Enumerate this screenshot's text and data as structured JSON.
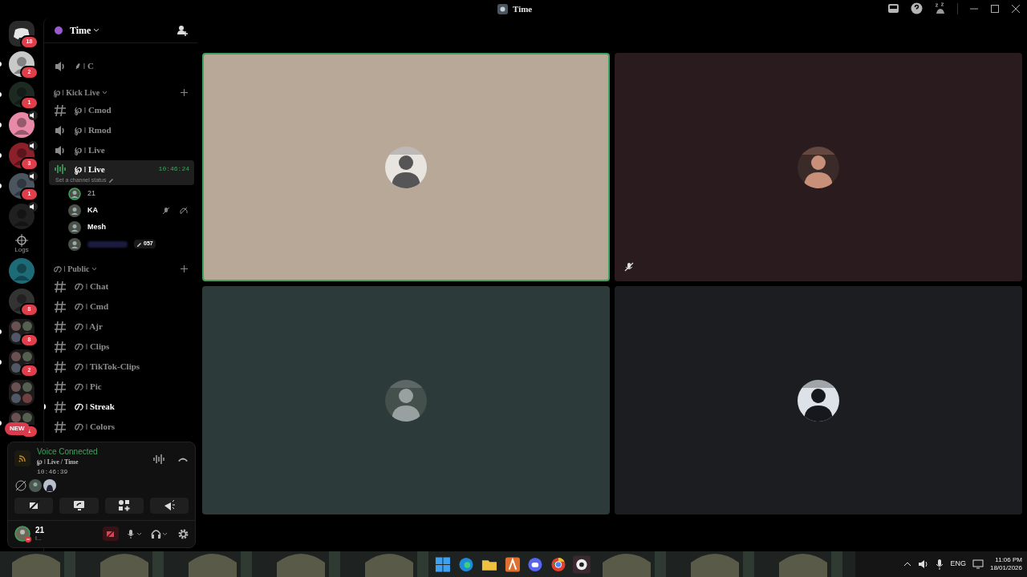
{
  "titlebar": {
    "title": "Time"
  },
  "servers": [
    {
      "kind": "home",
      "badge": "18",
      "speaker": false,
      "unread": false
    },
    {
      "kind": "avatar",
      "badge": "2",
      "speaker": false,
      "unread": true
    },
    {
      "kind": "avatar",
      "badge": "1",
      "speaker": false,
      "unread": true
    },
    {
      "kind": "avatar",
      "speaker": true,
      "unread": true
    },
    {
      "kind": "avatar",
      "badge": "3",
      "speaker": true,
      "unread": true
    },
    {
      "kind": "avatar",
      "badge": "1",
      "speaker": true,
      "unread": true
    },
    {
      "kind": "avatar",
      "speaker": true,
      "unread": false
    },
    {
      "kind": "logs",
      "label": "Logs",
      "speaker": false,
      "unread": false
    },
    {
      "kind": "avatar",
      "speaker": false,
      "unread": false
    },
    {
      "kind": "avatar",
      "badge": "8",
      "speaker": false,
      "unread": false
    },
    {
      "kind": "folder",
      "badge": "8",
      "speaker": false,
      "unread": true
    },
    {
      "kind": "folder",
      "badge": "2",
      "speaker": false,
      "unread": true
    },
    {
      "kind": "folder",
      "speaker": false,
      "unread": false
    },
    {
      "kind": "folder",
      "badge": "1",
      "speaker": false,
      "unread": true
    }
  ],
  "new_badge": "NEW",
  "guild": {
    "name": "Time"
  },
  "channels": [
    {
      "kind": "voice",
      "name": "⸙ ǀ C",
      "selected": false,
      "unread": false
    },
    {
      "kind": "category",
      "name": "℘ ǀ Kick Live"
    },
    {
      "kind": "text",
      "name": "℘ ǀ Cmod",
      "selected": false,
      "unread": false
    },
    {
      "kind": "voice",
      "name": "℘ ǀ Rmod",
      "selected": false,
      "unread": false
    },
    {
      "kind": "voice",
      "name": "℘ ǀ Live",
      "selected": false,
      "unread": false
    },
    {
      "kind": "voice",
      "name": "℘ ǀ Live",
      "selected": true,
      "unread": false,
      "timer": "10:46:24",
      "status": "Set a channel status",
      "children": [
        {
          "name": "21",
          "speaking": true,
          "muted": false
        },
        {
          "name": "KA",
          "speaking": false,
          "muted": true
        },
        {
          "name": "Mesh",
          "speaking": false,
          "muted": false
        },
        {
          "tag": "057",
          "speaking": false,
          "muted": false
        }
      ]
    },
    {
      "kind": "category",
      "name": "の ǀ Public"
    },
    {
      "kind": "text",
      "name": "の ǀ Chat",
      "selected": false,
      "unread": false
    },
    {
      "kind": "text",
      "name": "の ǀ Cmd",
      "selected": false,
      "unread": false
    },
    {
      "kind": "text",
      "name": "の ǀ Ajr",
      "selected": false,
      "unread": false
    },
    {
      "kind": "text",
      "name": "の ǀ Clips",
      "selected": false,
      "unread": false
    },
    {
      "kind": "text",
      "name": "の ǀ TikTok-Clips",
      "selected": false,
      "unread": false
    },
    {
      "kind": "text",
      "name": "の ǀ Pic",
      "selected": false,
      "unread": false
    },
    {
      "kind": "text",
      "name": "の ǀ Streak",
      "selected": false,
      "unread": true
    },
    {
      "kind": "text",
      "name": "の ǀ Colors",
      "selected": false,
      "unread": false
    }
  ],
  "voice_panel": {
    "status": "Voice Connected",
    "channel": "℘ ǀ Live / Time",
    "elapsed": "10:46:39"
  },
  "user_panel": {
    "name": "21",
    "status": "I...",
    "camera_off": true
  },
  "tiles": [
    {
      "color": "#b8a898",
      "speaking": true,
      "muted": false
    },
    {
      "color": "#2a1c1e",
      "speaking": false,
      "muted": true
    },
    {
      "color": "#2c3a39",
      "speaking": false,
      "muted": false
    },
    {
      "color": "#1b1d20",
      "speaking": false,
      "muted": false
    }
  ],
  "taskbar": {
    "language": "ENG",
    "time": "11:06 PM",
    "date": "18/01/2026"
  }
}
